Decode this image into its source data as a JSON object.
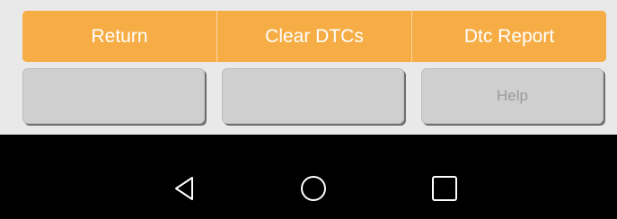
{
  "action_bar": {
    "buttons": [
      {
        "label": "Return"
      },
      {
        "label": "Clear DTCs"
      },
      {
        "label": "Dtc Report"
      }
    ],
    "color": "#f7ad45"
  },
  "secondary_row": {
    "buttons": [
      {
        "label": ""
      },
      {
        "label": ""
      },
      {
        "label": "Help"
      }
    ]
  },
  "nav_bar": {
    "icons": [
      "back-triangle-icon",
      "home-circle-icon",
      "recents-square-icon"
    ]
  }
}
